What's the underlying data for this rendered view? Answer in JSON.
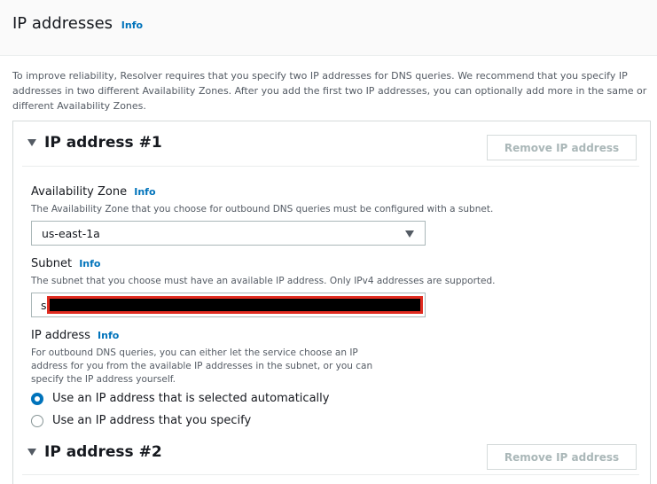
{
  "panel": {
    "title": "IP addresses",
    "info_label": "Info",
    "intro": "To improve reliability, Resolver requires that you specify two IP addresses for DNS queries. We recommend that you specify IP addresses in two different Availability Zones. After you add the first two IP addresses, you can optionally add more in the same or different Availability Zones."
  },
  "sections": [
    {
      "title": "IP address #1",
      "remove_label": "Remove IP address",
      "availability_zone": {
        "label": "Availability Zone",
        "info_label": "Info",
        "description": "The Availability Zone that you choose for outbound DNS queries must be configured with a subnet.",
        "selected_value": "us-east-1a"
      },
      "subnet": {
        "label": "Subnet",
        "info_label": "Info",
        "description": "The subnet that you choose must have an available IP address. Only IPv4 addresses are supported.",
        "value_prefix": "s"
      },
      "ip_address": {
        "label": "IP address",
        "info_label": "Info",
        "description": "For outbound DNS queries, you can either let the service choose an IP address for you from the available IP addresses in the subnet, or you can specify the IP address yourself.",
        "options": [
          {
            "label": "Use an IP address that is selected automatically",
            "checked": true
          },
          {
            "label": "Use an IP address that you specify",
            "checked": false
          }
        ]
      }
    },
    {
      "title": "IP address #2",
      "remove_label": "Remove IP address"
    }
  ],
  "colors": {
    "link": "#0073bb",
    "redaction_border": "#e02b20",
    "disabled_text": "#aab7b8"
  }
}
